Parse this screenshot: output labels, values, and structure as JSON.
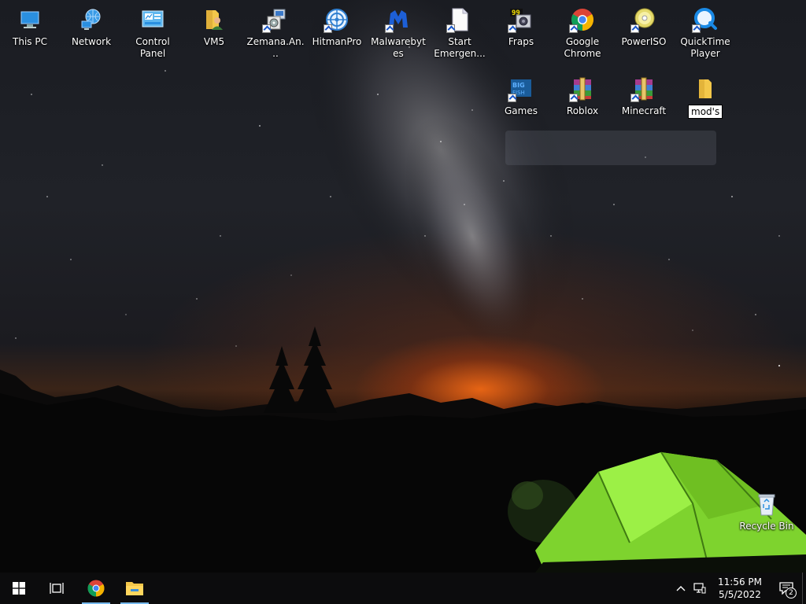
{
  "desktop": {
    "icons": {
      "this_pc": "This PC",
      "network": "Network",
      "control_panel": "Control Panel",
      "vm5": "VM5",
      "zemana": "Zemana.An...",
      "hitmanpro": "HitmanPro",
      "malwarebytes": "Malwarebytes",
      "start_emergency": "Start Emergen...",
      "fraps": "Fraps",
      "google_chrome": "Google Chrome",
      "poweriso": "PowerISO",
      "quicktime": "QuickTime Player",
      "games": "Games",
      "roblox": "Roblox",
      "minecraft": "Minecraft",
      "recycle_bin": "Recycle Bin"
    },
    "rename_folder": {
      "value": "mod's"
    }
  },
  "taskbar": {
    "clock_time": "11:56 PM",
    "clock_date": "5/5/2022",
    "notification_count": "2"
  },
  "colors": {
    "taskbar_bg": "#0c0c0d",
    "running_indicator": "#76b9ed",
    "folder_yellow": "#f3c74a",
    "tent_green": "#8fe63a",
    "horizon_orange": "#ff6e14"
  }
}
